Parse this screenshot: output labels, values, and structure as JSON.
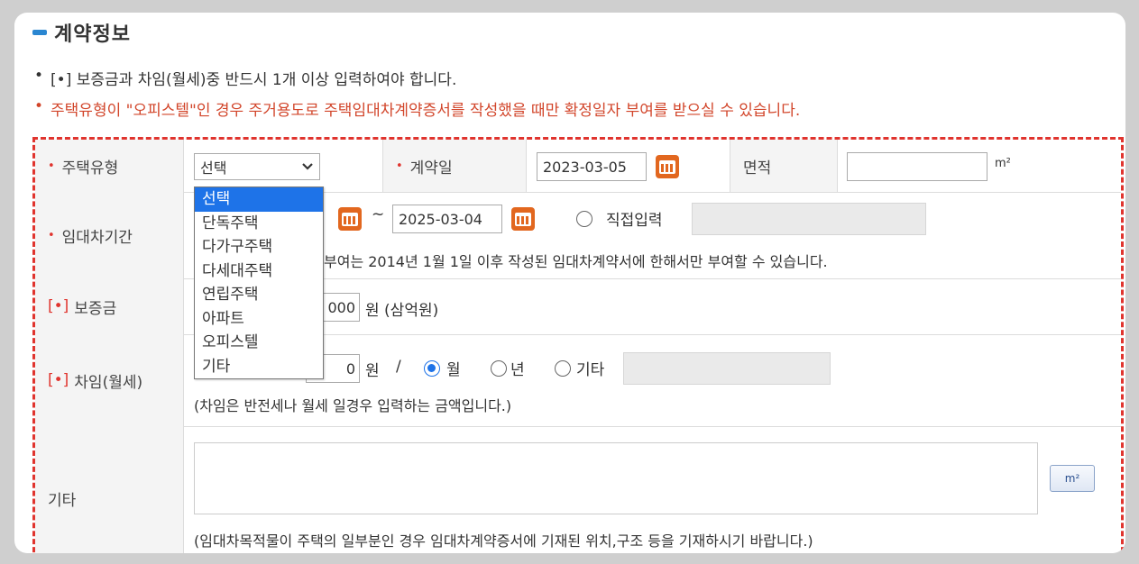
{
  "section": {
    "title": "계약정보"
  },
  "notes": [
    {
      "bullet": "•",
      "text": "[•] 보증금과 차임(월세)중 반드시 1개 이상 입력하여야 합니다."
    },
    {
      "bullet": "•",
      "text": "주택유형이 \"오피스텔\"인 경우 주거용도로 주택임대차계약증서를 작성했을 때만 확정일자 부여를 받으실 수 있습니다."
    }
  ],
  "fields": {
    "housing_type": {
      "label": "주택유형",
      "selected": "선택",
      "options": [
        "선택",
        "단독주택",
        "다가구주택",
        "다세대주택",
        "연립주택",
        "아파트",
        "오피스텔",
        "기타"
      ]
    },
    "contract_date": {
      "label": "계약일",
      "value": "2023-03-05"
    },
    "area": {
      "label": "면적",
      "value": "",
      "unit": "m²"
    },
    "lease_period": {
      "label": "임대차기간",
      "end": "2025-03-04",
      "tilde": "~",
      "direct_input_label": "직접입력",
      "note": "부여는 2014년 1월 1일 이후 작성된 임대차계약서에 한해서만 부여할 수 있습니다."
    },
    "deposit": {
      "label": "보증금",
      "required_mark": "[•]",
      "value_tail": "000",
      "unit_text": "원 (삼억원)"
    },
    "rent": {
      "label": "차임(월세)",
      "required_mark": "[•]",
      "value": "0",
      "unit": "원",
      "slash": "/",
      "options": [
        "월",
        "년",
        "기타"
      ],
      "selected": "월",
      "note": "(차임은 반전세나 월세 일경우 입력하는 금액입니다.)"
    },
    "other": {
      "label": "기타",
      "button_label": "m²",
      "note": "(임대차목적물이 주택의 일부분인 경우 임대차계약증서에 기재된 위치,구조 등을 기재하시기 바랍니다.)"
    }
  },
  "colors": {
    "accent_red": "#e0342e",
    "accent_blue": "#1e73e8",
    "calendar_orange": "#e2671f"
  },
  "icons": {
    "calendar": "calendar-icon",
    "dropdown": "chevron-down-icon"
  }
}
